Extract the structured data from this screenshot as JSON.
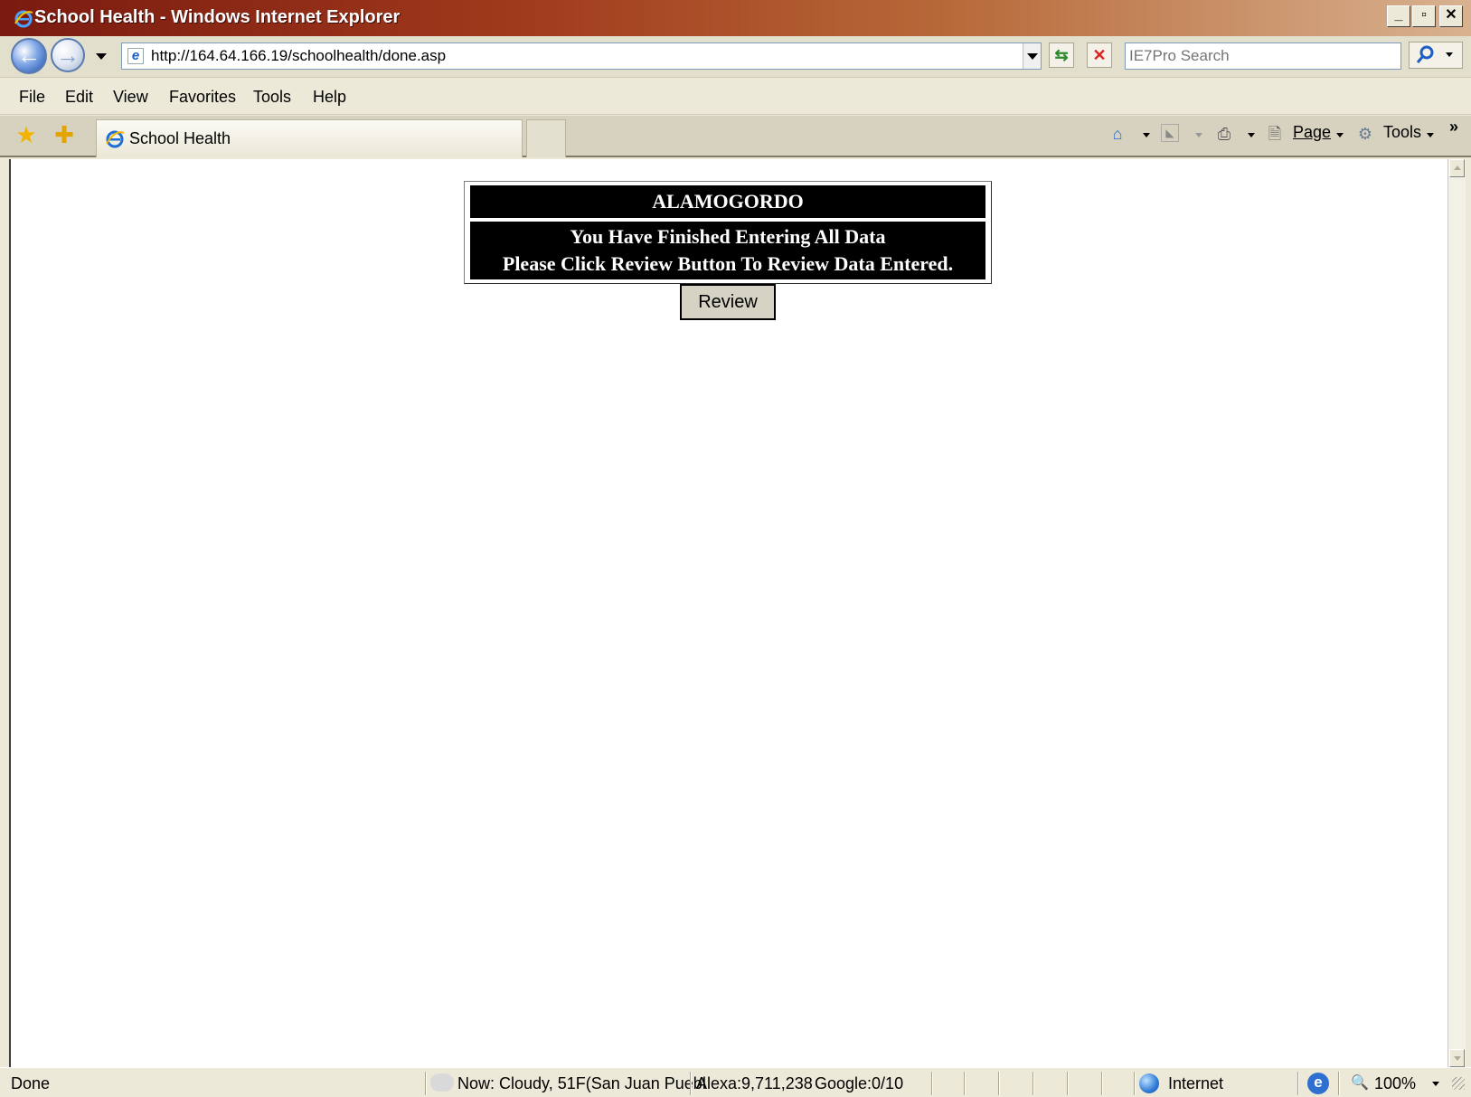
{
  "window": {
    "title": "School Health - Windows Internet Explorer"
  },
  "address": {
    "url": "http://164.64.166.19/schoolhealth/done.asp",
    "search_placeholder": "IE7Pro Search"
  },
  "menu": [
    {
      "label": "File",
      "mnemonic": "F"
    },
    {
      "label": "Edit",
      "mnemonic": "E"
    },
    {
      "label": "View",
      "mnemonic": "V"
    },
    {
      "label": "Favorites",
      "mnemonic": "a"
    },
    {
      "label": "Tools",
      "mnemonic": "T"
    },
    {
      "label": "Help",
      "mnemonic": "H"
    }
  ],
  "tab": {
    "label": "School Health"
  },
  "commandbar": {
    "page_label": "Page",
    "tools_label": "Tools"
  },
  "page": {
    "header": "ALAMOGORDO",
    "message_line1": "You Have Finished Entering All Data",
    "message_line2": "Please Click Review Button To Review Data Entered.",
    "review_button": "Review"
  },
  "status": {
    "text": "Done",
    "weather": "Now: Cloudy, 51F(San Juan Puebl",
    "alexa": "Alexa:9,711,238",
    "google": "Google:0/10",
    "zone": "Internet",
    "zoom": "100%"
  },
  "colors": {
    "title_bar": "#7a1a10",
    "panel_bg": "#000000",
    "panel_text": "#ffffff",
    "page_bg": "#ffffff",
    "chrome_bg": "#ece9d8"
  },
  "icons": [
    "ie-logo-icon",
    "back-icon",
    "forward-icon",
    "refresh-icon",
    "stop-icon",
    "search-icon",
    "favorites-star-icon",
    "add-favorite-icon",
    "home-icon",
    "feeds-icon",
    "print-icon",
    "page-icon",
    "tools-gear-icon",
    "globe-icon",
    "zoom-icon"
  ]
}
